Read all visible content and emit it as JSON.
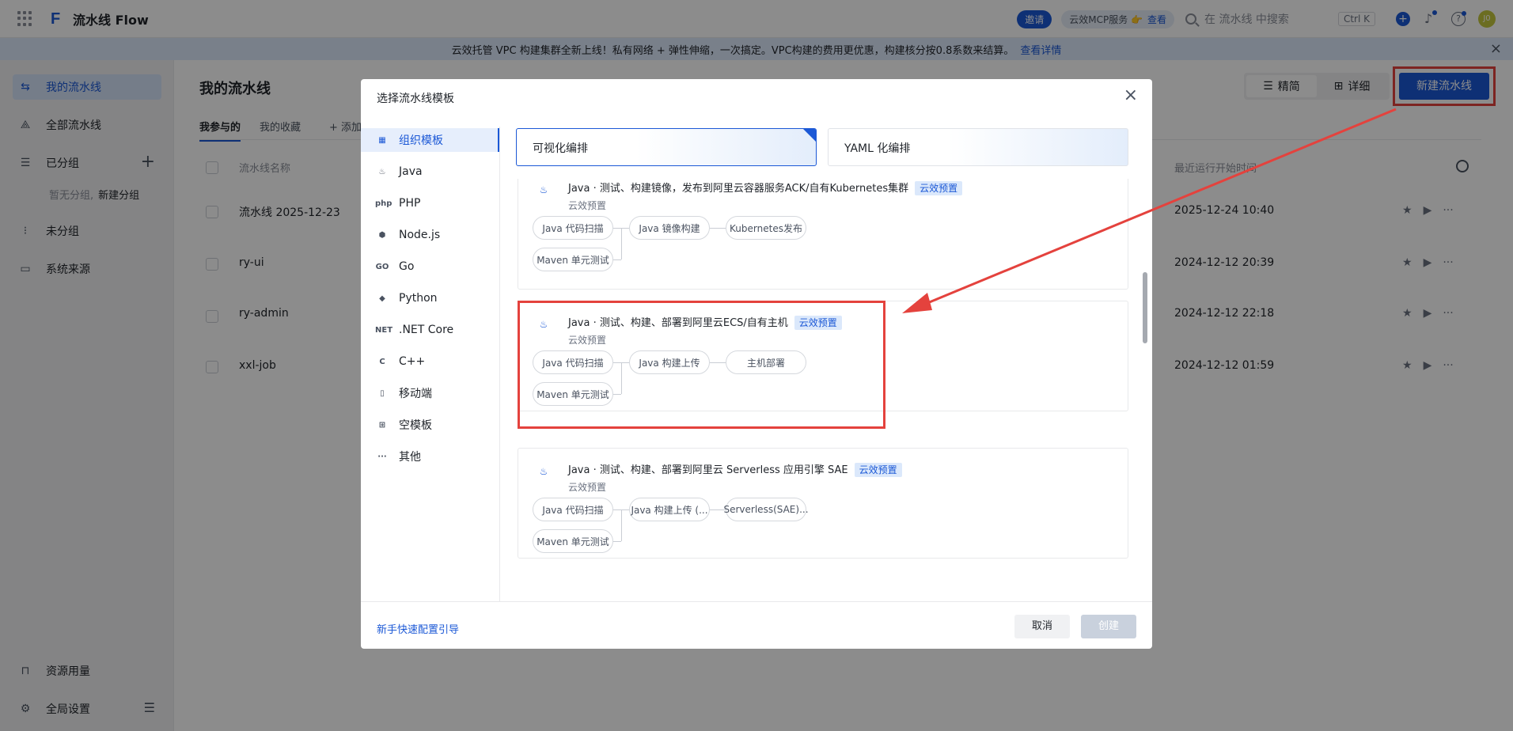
{
  "app": {
    "title": "流水线 Flow"
  },
  "topbar": {
    "invite": "邀请",
    "mcp": "云效MCP服务 👉",
    "mcp_link": "查看",
    "search_placeholder": "在 流水线 中搜索",
    "shortcut": "Ctrl K",
    "avatar": "J0"
  },
  "banner": {
    "text": "云效托管 VPC 构建集群全新上线！私有网络 + 弹性伸缩，一次搞定。VPC构建的费用更优惠，构建核分按0.8系数来结算。",
    "link": "查看详情"
  },
  "sidebar": {
    "items": [
      {
        "label": "我的流水线",
        "icon": "pipeline-icon"
      },
      {
        "label": "全部流水线",
        "icon": "nodes-icon"
      },
      {
        "label": "已分组",
        "icon": "list-icon"
      },
      {
        "label": "未分组",
        "icon": "ungroup-icon"
      },
      {
        "label": "系统来源",
        "icon": "monitor-icon"
      }
    ],
    "empty_group": "暂无分组,",
    "new_group": "新建分组",
    "bottom": [
      {
        "label": "资源用量",
        "icon": "inbox-icon"
      },
      {
        "label": "全局设置",
        "icon": "gear-icon"
      }
    ]
  },
  "main": {
    "title": "我的流水线",
    "tabs": [
      "我参与的",
      "我的收藏",
      "添加"
    ],
    "view_simple": "精简",
    "view_detail": "详细",
    "new_button": "新建流水线",
    "columns": {
      "name": "流水线名称",
      "last_run": "最近运行开始时间"
    },
    "rows": [
      {
        "name": "流水线 2025-12-23",
        "time": "2025-12-24 10:40"
      },
      {
        "name": "ry-ui",
        "time": "2024-12-12 20:39"
      },
      {
        "name": "ry-admin",
        "time": "2024-12-12 22:18"
      },
      {
        "name": "xxl-job",
        "time": "2024-12-12 01:59"
      }
    ]
  },
  "modal": {
    "title": "选择流水线模板",
    "categories": [
      {
        "label": "组织模板",
        "icon": "grid-icon",
        "glyph": "▦"
      },
      {
        "label": "Java",
        "icon": "java-icon",
        "glyph": "♨"
      },
      {
        "label": "PHP",
        "icon": "php-icon",
        "glyph": "php"
      },
      {
        "label": "Node.js",
        "icon": "nodejs-icon",
        "glyph": "⬢"
      },
      {
        "label": "Go",
        "icon": "go-icon",
        "glyph": "GO"
      },
      {
        "label": "Python",
        "icon": "python-icon",
        "glyph": "◆"
      },
      {
        "label": ".NET Core",
        "icon": "dotnet-icon",
        "glyph": "NET"
      },
      {
        "label": "C++",
        "icon": "cpp-icon",
        "glyph": "C"
      },
      {
        "label": "移动端",
        "icon": "mobile-icon",
        "glyph": "▯"
      },
      {
        "label": "空模板",
        "icon": "blank-template-icon",
        "glyph": "⊞"
      },
      {
        "label": "其他",
        "icon": "more-icon",
        "glyph": "···"
      }
    ],
    "modes": [
      "可视化编排",
      "YAML 化编排"
    ],
    "templates": [
      {
        "title": "Java · 测试、构建镜像，发布到阿里云容器服务ACK/自有Kubernetes集群",
        "tag": "云效预置",
        "sub": "云效预置",
        "nodes": [
          "Java 代码扫描",
          "Java 镜像构建",
          "Kubernetes发布",
          "Maven 单元测试"
        ]
      },
      {
        "title": "Java · 测试、构建、部署到阿里云ECS/自有主机",
        "tag": "云效预置",
        "sub": "云效预置",
        "nodes": [
          "Java 代码扫描",
          "Java 构建上传",
          "主机部署",
          "Maven 单元测试"
        ]
      },
      {
        "title": "Java · 测试、构建、部署到阿里云 Serverless 应用引擎 SAE",
        "tag": "云效预置",
        "sub": "云效预置",
        "nodes": [
          "Java 代码扫描",
          "Java 构建上传 (...",
          "Serverless(SAE)...",
          "Maven 单元测试"
        ]
      }
    ],
    "guide": "新手快速配置引导",
    "cancel": "取消",
    "create": "创建"
  },
  "colors": {
    "primary": "#1b58d6",
    "annotation": "#e4423d"
  }
}
